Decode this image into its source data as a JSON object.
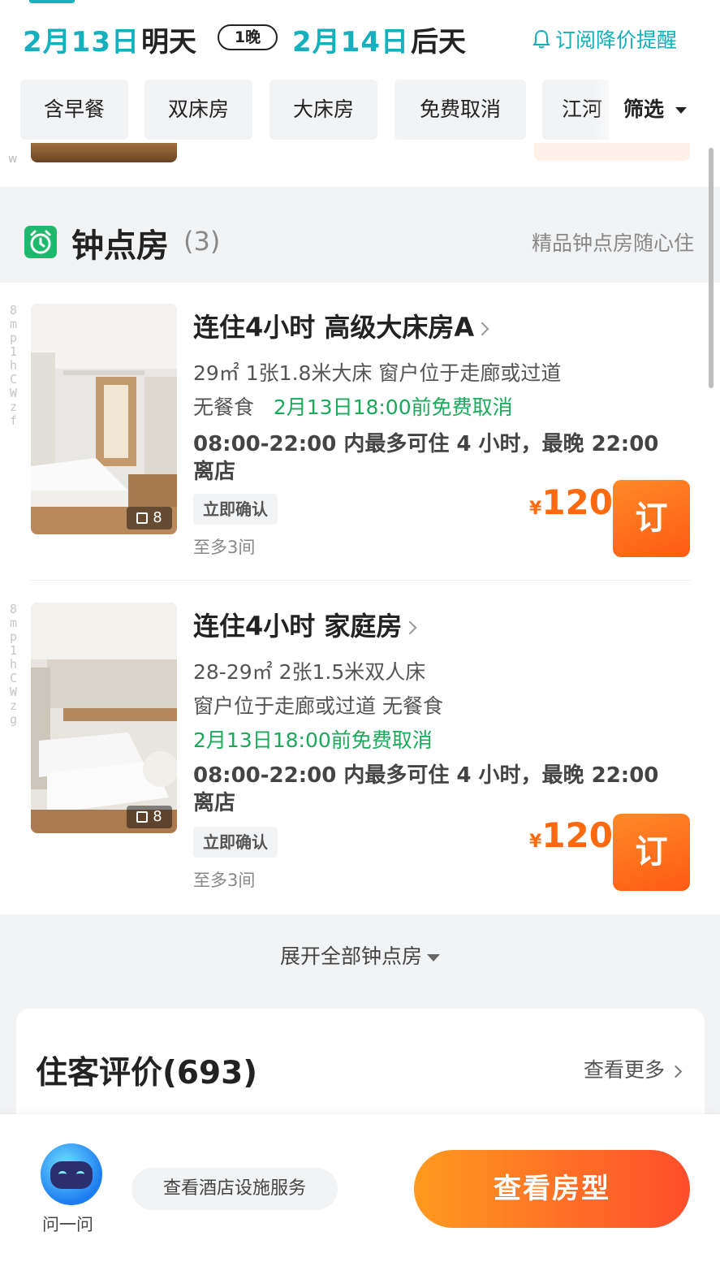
{
  "date_bar": {
    "checkin_date": "2月13日",
    "checkin_word": "明天",
    "nights": "1晚",
    "checkout_date": "2月14日",
    "checkout_word": "后天",
    "subscribe_label": "订阅降价提醒"
  },
  "filters": {
    "chips": [
      "含早餐",
      "双床房",
      "大床房",
      "免费取消",
      "江河"
    ],
    "filter_label": "筛选"
  },
  "strip_code": "w",
  "hourly_section": {
    "title": "钟点房",
    "count": "(3)",
    "slogan": "精品钟点房随心住"
  },
  "rooms": [
    {
      "code": "8mp1hCWzf",
      "photo_count": "8",
      "name": "连住4小时  高级大床房A",
      "line1": "29㎡   1张1.8米大床   窗户位于走廊或过道",
      "meal": "无餐食",
      "cancel": "2月13日18:00前免费取消",
      "line2": "",
      "hours_text": "08:00-22:00 内最多可住 4 小时，最晚 22:00 离店",
      "tag": "立即确认",
      "max_rooms": "至多3间",
      "currency": "¥",
      "price": "120",
      "book_label": "订"
    },
    {
      "code": "8mp1hCWzg",
      "photo_count": "8",
      "name": "连住4小时  家庭房",
      "line1": "28-29㎡   2张1.5米双人床",
      "meal": "",
      "cancel": "2月13日18:00前免费取消",
      "line2": "窗户位于走廊或过道   无餐食",
      "hours_text": "08:00-22:00 内最多可住 4 小时，最晚 22:00 离店",
      "tag": "立即确认",
      "max_rooms": "至多3间",
      "currency": "¥",
      "price": "120",
      "book_label": "订"
    }
  ],
  "expand_label": "展开全部钟点房",
  "reviews": {
    "title": "住客评价(693)",
    "more_label": "查看更多"
  },
  "bottom": {
    "ask_label": "问一问",
    "facility_label": "查看酒店设施服务",
    "view_rooms_label": "查看房型"
  },
  "colors": {
    "accent": "#14b0bd",
    "green": "#1aaa5c",
    "orange": "#ff6a10"
  }
}
